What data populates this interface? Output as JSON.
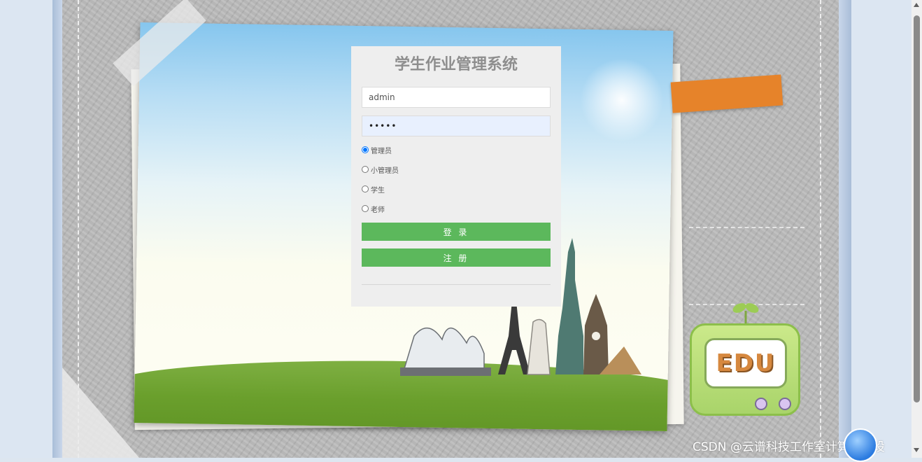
{
  "login": {
    "title": "学生作业管理系统",
    "username_value": "admin",
    "password_value": "•••••",
    "roles": [
      {
        "label": "管理员",
        "checked": true
      },
      {
        "label": "小管理员",
        "checked": false
      },
      {
        "label": "学生",
        "checked": false
      },
      {
        "label": "老师",
        "checked": false
      }
    ],
    "login_label": "登 录",
    "register_label": "注 册"
  },
  "decor": {
    "edu_label": "EDU",
    "watermark": "CSDN @云谱科技工作室计算机毕设"
  },
  "colors": {
    "button": "#5cb85c",
    "tape": "#e6832a",
    "board": "#b9b9b9"
  }
}
